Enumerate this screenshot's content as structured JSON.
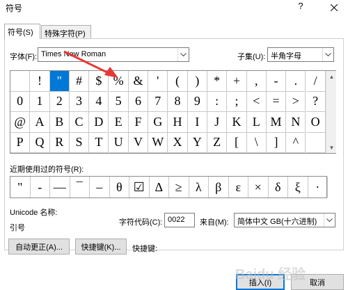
{
  "window": {
    "title": "符号",
    "help_label": "?",
    "close_label": "×"
  },
  "tabs": [
    {
      "label": "符号(S)",
      "active": true
    },
    {
      "label": "特殊字符(P)",
      "active": false
    }
  ],
  "font": {
    "label": "字体(F):",
    "value": "Times New Roman"
  },
  "subset": {
    "label": "子集(U):",
    "value": "半角字母"
  },
  "symbols": {
    "rows": [
      [
        "",
        "!",
        "\"",
        "#",
        "$",
        "%",
        "&",
        "'",
        "(",
        ")",
        "*",
        "+",
        ",",
        "-",
        ".",
        "/"
      ],
      [
        "0",
        "1",
        "2",
        "3",
        "4",
        "5",
        "6",
        "7",
        "8",
        "9",
        ":",
        ";",
        "<",
        "=",
        ">",
        "?"
      ],
      [
        "@",
        "A",
        "B",
        "C",
        "D",
        "E",
        "F",
        "G",
        "H",
        "I",
        "J",
        "K",
        "L",
        "M",
        "N",
        "O"
      ],
      [
        "P",
        "Q",
        "R",
        "S",
        "T",
        "U",
        "V",
        "W",
        "X",
        "Y",
        "Z",
        "[",
        "\\",
        "]",
        "^",
        ""
      ]
    ],
    "selected": "\""
  },
  "recent": {
    "label": "近期使用过的符号(R):",
    "items": [
      "\"",
      "-",
      "—",
      "¯",
      "–",
      "θ",
      "☑",
      "Δ",
      "≥",
      "λ",
      "β",
      "ε",
      "×",
      "δ",
      "ξ",
      "·"
    ]
  },
  "unicode": {
    "name_label": "Unicode 名称:",
    "name_value": "引号",
    "code_label": "字符代码(C):",
    "code_value": "0022",
    "from_label": "来自(M):",
    "from_value": "简体中文 GB(十六进制)"
  },
  "buttons": {
    "autocorrect": "自动更正(A)...",
    "shortcut": "快捷键(K)...",
    "shortcut_label": "快捷键:",
    "insert": "插入(I)",
    "cancel": "取消"
  },
  "watermark": "Baidu 经验",
  "colors": {
    "selection": "#0078d7",
    "annotation_arrow": "#e53935"
  }
}
